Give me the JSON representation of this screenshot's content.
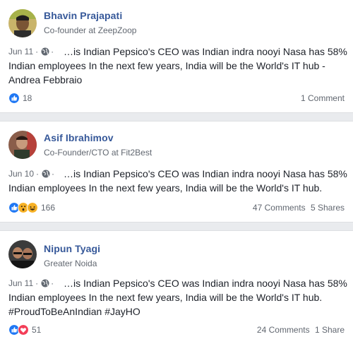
{
  "posts": [
    {
      "author": "Bhavin Prajapati",
      "subtitle": "Co-founder at ZeepZoop",
      "date": "Jun 11",
      "lines": [
        "…is Indian Pepsico's CEO was Indian indra nooyi Nasa has 58%",
        "Indian employees In the next few years, India will be the World's IT hub -",
        "Andrea Febbraio"
      ],
      "reaction_count": "18",
      "reactions": [
        "like-icon"
      ],
      "comments": "1 Comment",
      "shares": ""
    },
    {
      "author": "Asif Ibrahimov",
      "subtitle": "Co-Founder/CTO at Fit2Best",
      "date": "Jun 10",
      "lines": [
        "…is Indian Pepsico's CEO was Indian indra nooyi Nasa has 58%",
        "Indian employees In the next few years, India will be the World's IT hub."
      ],
      "reaction_count": "166",
      "reactions": [
        "like-icon",
        "wow-icon",
        "haha-icon"
      ],
      "comments": "47 Comments",
      "shares": "5 Shares"
    },
    {
      "author": "Nipun Tyagi",
      "subtitle": "Greater Noida",
      "date": "Jun 11",
      "lines": [
        "…is Indian Pepsico's CEO was Indian indra nooyi Nasa has 58%",
        "Indian employees In the next few years, India will be the World's IT hub.",
        "#ProudToBeAnIndian #JayHO"
      ],
      "reaction_count": "51",
      "reactions": [
        "like-icon",
        "love-icon"
      ],
      "comments": "24 Comments",
      "shares": "1 Share"
    }
  ],
  "separator": "·",
  "colors": {
    "like": "#2078f4",
    "love": "#f33e58",
    "reaction_yellow": "#f7b125",
    "name": "#365899",
    "muted": "#616770"
  }
}
